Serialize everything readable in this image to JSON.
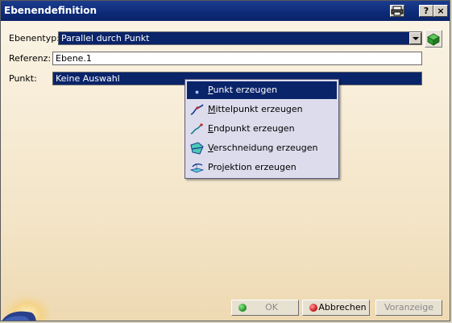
{
  "window": {
    "title": "Ebenendefinition",
    "print_icon": "printer-icon",
    "help_label": "?",
    "close_label": "×"
  },
  "form": {
    "ebenentyp_label": "Ebenentyp:",
    "ebenentyp_value": "Parallel durch Punkt",
    "referenz_label": "Referenz:",
    "referenz_value": "Ebene.1",
    "punkt_label": "Punkt:",
    "punkt_value": "Keine Auswahl"
  },
  "context_menu": {
    "items": [
      {
        "accel": "P",
        "rest": "unkt erzeugen",
        "icon": "point-icon"
      },
      {
        "accel": "M",
        "rest": "ittelpunkt erzeugen",
        "icon": "midpoint-icon"
      },
      {
        "accel": "E",
        "rest": "ndpunkt erzeugen",
        "icon": "endpoint-icon"
      },
      {
        "accel": "V",
        "rest": "erschneidung erzeugen",
        "icon": "intersection-icon"
      },
      {
        "pre": "Pro",
        "accel": "j",
        "rest": "ektion erzeugen",
        "icon": "projection-icon"
      }
    ]
  },
  "buttons": {
    "ok": "OK",
    "cancel": "Abbrechen",
    "preview": "Voranzeige"
  },
  "colors": {
    "titlebar": "#0c2a78",
    "selection": "#0a246a",
    "ok_dot": "#2a9a2a",
    "cancel_dot": "#d02020"
  }
}
